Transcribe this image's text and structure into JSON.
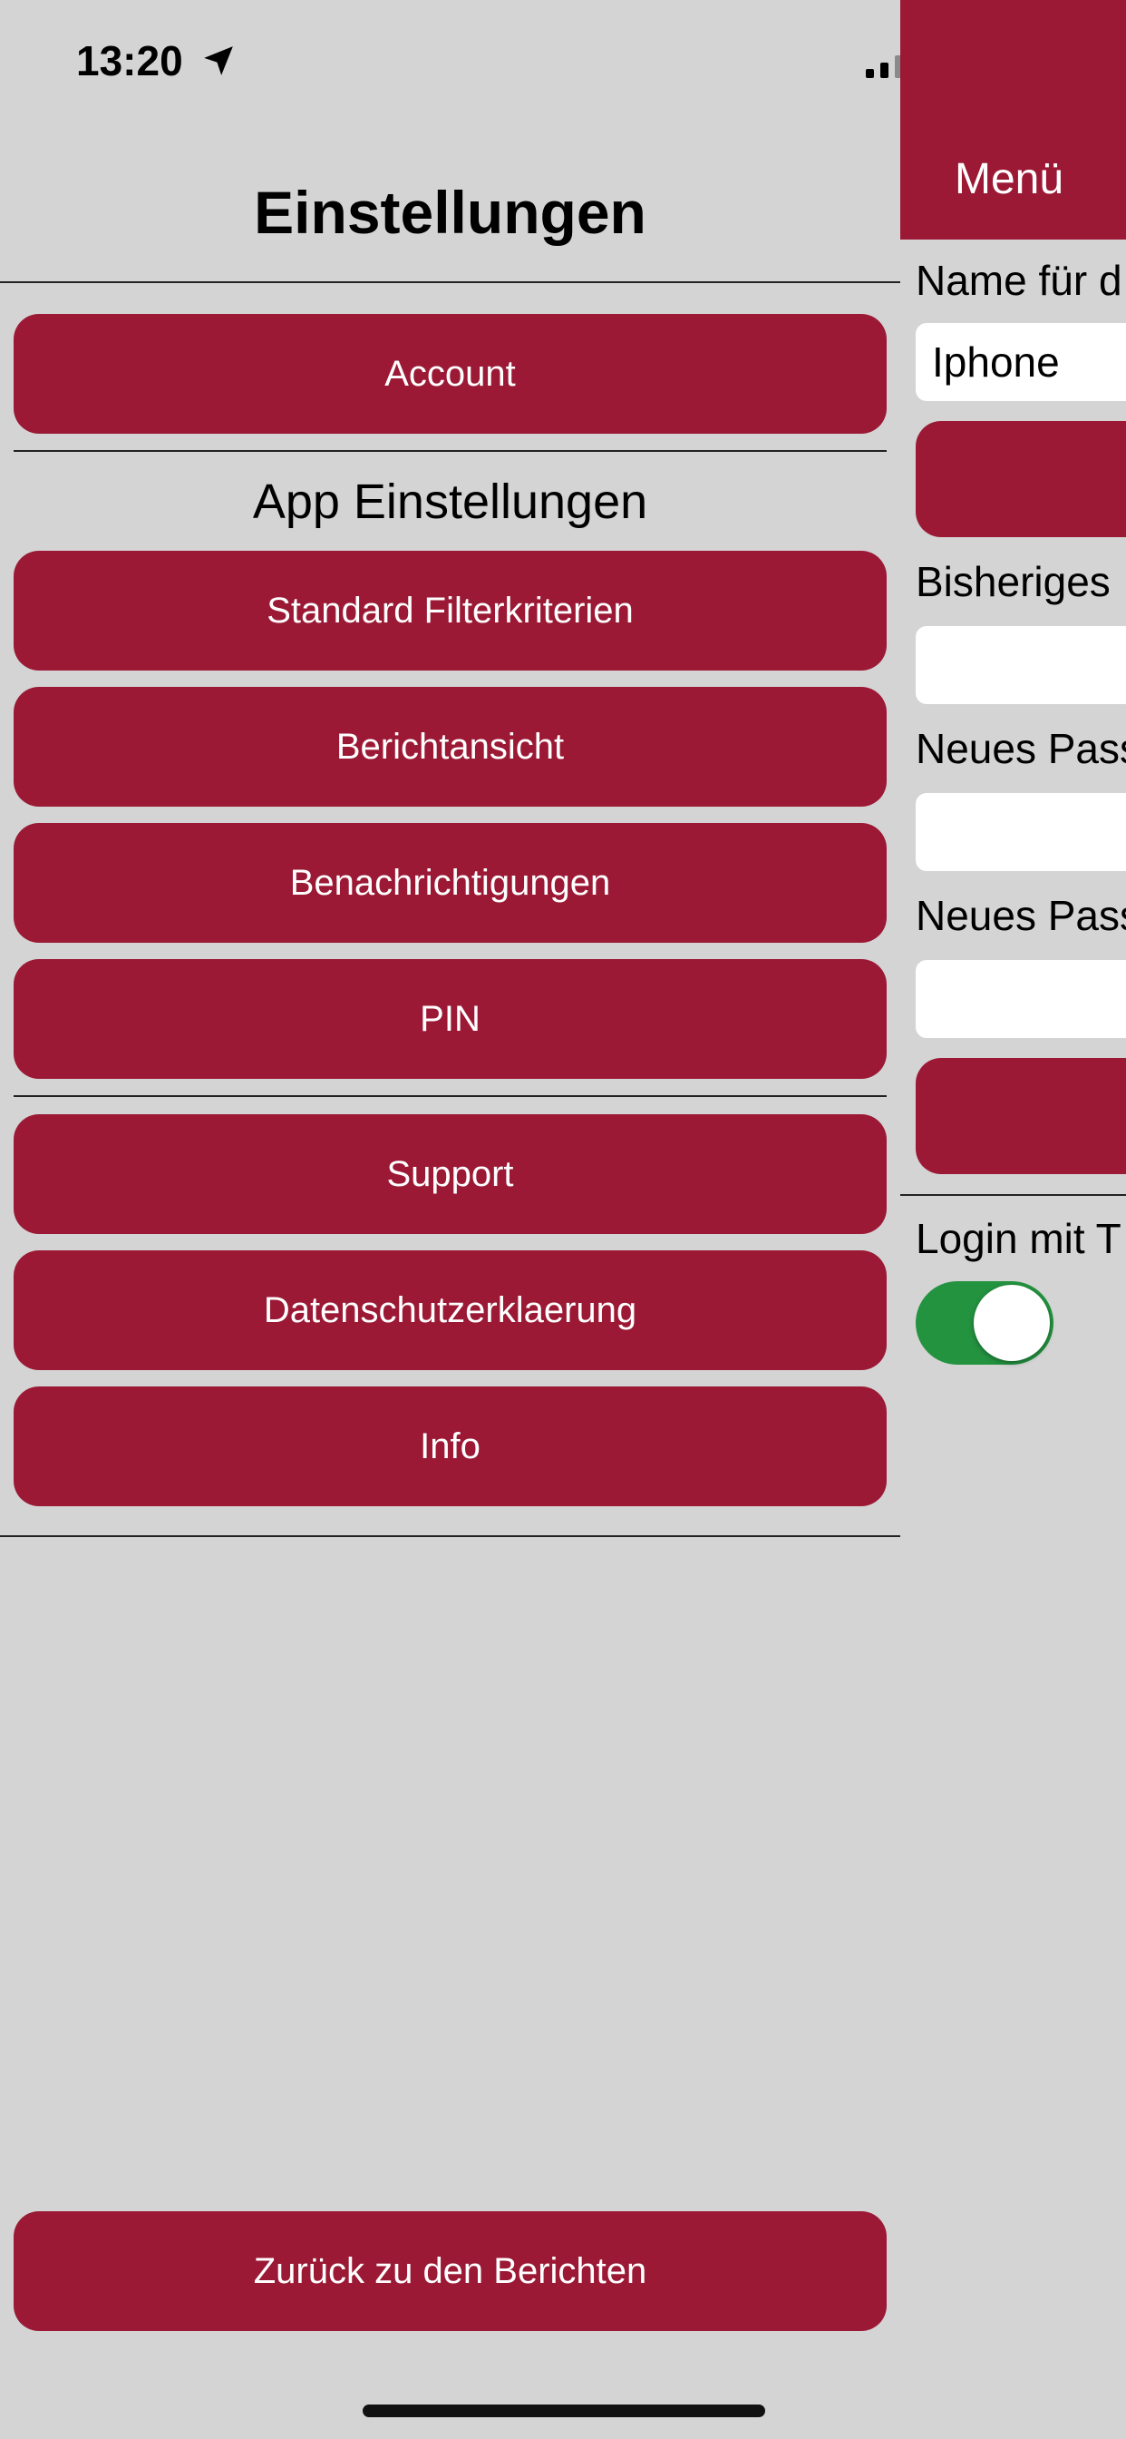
{
  "status_bar": {
    "time": "13:20"
  },
  "left_panel": {
    "title": "Einstellungen",
    "account_button": "Account",
    "app_section_title": "App Einstellungen",
    "app_buttons": [
      "Standard Filterkriterien",
      "Berichtansicht",
      "Benachrichtigungen",
      "PIN"
    ],
    "info_buttons": [
      "Support",
      "Datenschutzerklaerung",
      "Info"
    ],
    "back_button": "Zurück zu den Berichten"
  },
  "right_panel": {
    "menu_title": "Menü",
    "device_name_label": "Name für d",
    "device_name_value": "Iphone",
    "current_password_label": "Bisheriges",
    "new_password_label": "Neues Pass",
    "confirm_password_label": "Neues Pass",
    "login_touch_label": "Login mit T",
    "login_touch_enabled": true
  },
  "colors": {
    "accent": "#9b1935",
    "background": "#d4d4d4",
    "toggle_on": "#249340"
  }
}
